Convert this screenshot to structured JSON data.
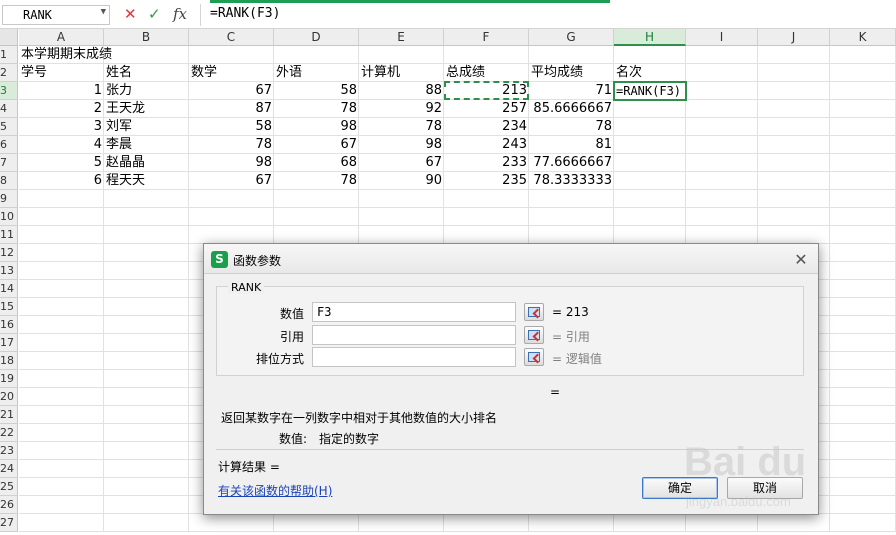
{
  "formula_bar": {
    "name_box": "RANK",
    "cancel_icon": "✕",
    "confirm_icon": "✓",
    "fx_label": "fx",
    "formula": "=RANK(F3)"
  },
  "columns": [
    "A",
    "B",
    "C",
    "D",
    "E",
    "F",
    "G",
    "H",
    "I",
    "J",
    "K"
  ],
  "selected_column": "H",
  "rows": [
    "1",
    "2",
    "3",
    "4",
    "5",
    "6",
    "7",
    "8",
    "9",
    "10",
    "11",
    "12",
    "13",
    "14",
    "15",
    "16",
    "17",
    "18",
    "19",
    "20",
    "21",
    "22",
    "23",
    "24",
    "25",
    "26",
    "27"
  ],
  "selected_row": "3",
  "sheet": {
    "title": "本学期期末成绩",
    "headers": [
      "学号",
      "姓名",
      "数学",
      "外语",
      "计算机",
      "总成绩",
      "平均成绩",
      "名次"
    ],
    "records": [
      [
        "1",
        "张力",
        "67",
        "58",
        "88",
        "213",
        "71",
        "=RANK(F3)"
      ],
      [
        "2",
        "王天龙",
        "87",
        "78",
        "92",
        "257",
        "85.6666667",
        ""
      ],
      [
        "3",
        "刘军",
        "58",
        "98",
        "78",
        "234",
        "78",
        ""
      ],
      [
        "4",
        "李晨",
        "78",
        "67",
        "98",
        "243",
        "81",
        ""
      ],
      [
        "5",
        "赵晶晶",
        "98",
        "68",
        "67",
        "233",
        "77.6666667",
        ""
      ],
      [
        "6",
        "程天天",
        "67",
        "78",
        "90",
        "235",
        "78.3333333",
        ""
      ]
    ]
  },
  "dialog": {
    "title": "函数参数",
    "logo": "S",
    "close_icon": "✕",
    "function_name": "RANK",
    "args": [
      {
        "label": "数值",
        "value": "F3",
        "result": "= 213"
      },
      {
        "label": "引用",
        "value": "",
        "result": "= 引用"
      },
      {
        "label": "排位方式",
        "value": "",
        "result": "= 逻辑值"
      }
    ],
    "equals": "=",
    "description": "返回某数字在一列数字中相对于其他数值的大小排名",
    "arg_desc_label": "数值:",
    "arg_desc_text": "指定的数字",
    "result_label": "计算结果 =",
    "help_link": "有关该函数的帮助(H)",
    "ok_label": "确定",
    "cancel_label": "取消"
  },
  "watermark": {
    "logo": "Bai du",
    "url": "jingyan.baidu.com"
  },
  "colors": {
    "accent_green": "#2e8f4a",
    "link_blue": "#1a43b8"
  }
}
